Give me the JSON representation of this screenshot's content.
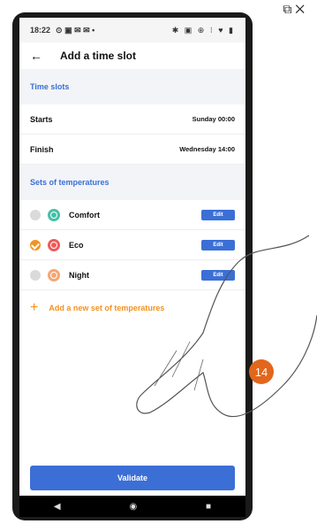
{
  "status": {
    "time": "18:22"
  },
  "appbar": {
    "title": "Add a time slot"
  },
  "time_slots": {
    "header": "Time slots",
    "starts_label": "Starts",
    "starts_value": "Sunday 00:00",
    "finish_label": "Finish",
    "finish_value": "Wednesday 14:00"
  },
  "temperatures": {
    "header": "Sets of temperatures",
    "items": [
      {
        "name": "Comfort",
        "edit": "Edit",
        "color": "#45c1a6",
        "selected": false
      },
      {
        "name": "Eco",
        "edit": "Edit",
        "color": "#f05a5a",
        "selected": true
      },
      {
        "name": "Night",
        "edit": "Edit",
        "color": "#f5a672",
        "selected": false
      }
    ],
    "add_label": "Add a new set of temperatures",
    "add_icon": "+"
  },
  "validate_label": "Validate",
  "badge": "14",
  "colors": {
    "accent": "#3b6fd6",
    "orange": "#f29222",
    "badge": "#e2661b"
  }
}
